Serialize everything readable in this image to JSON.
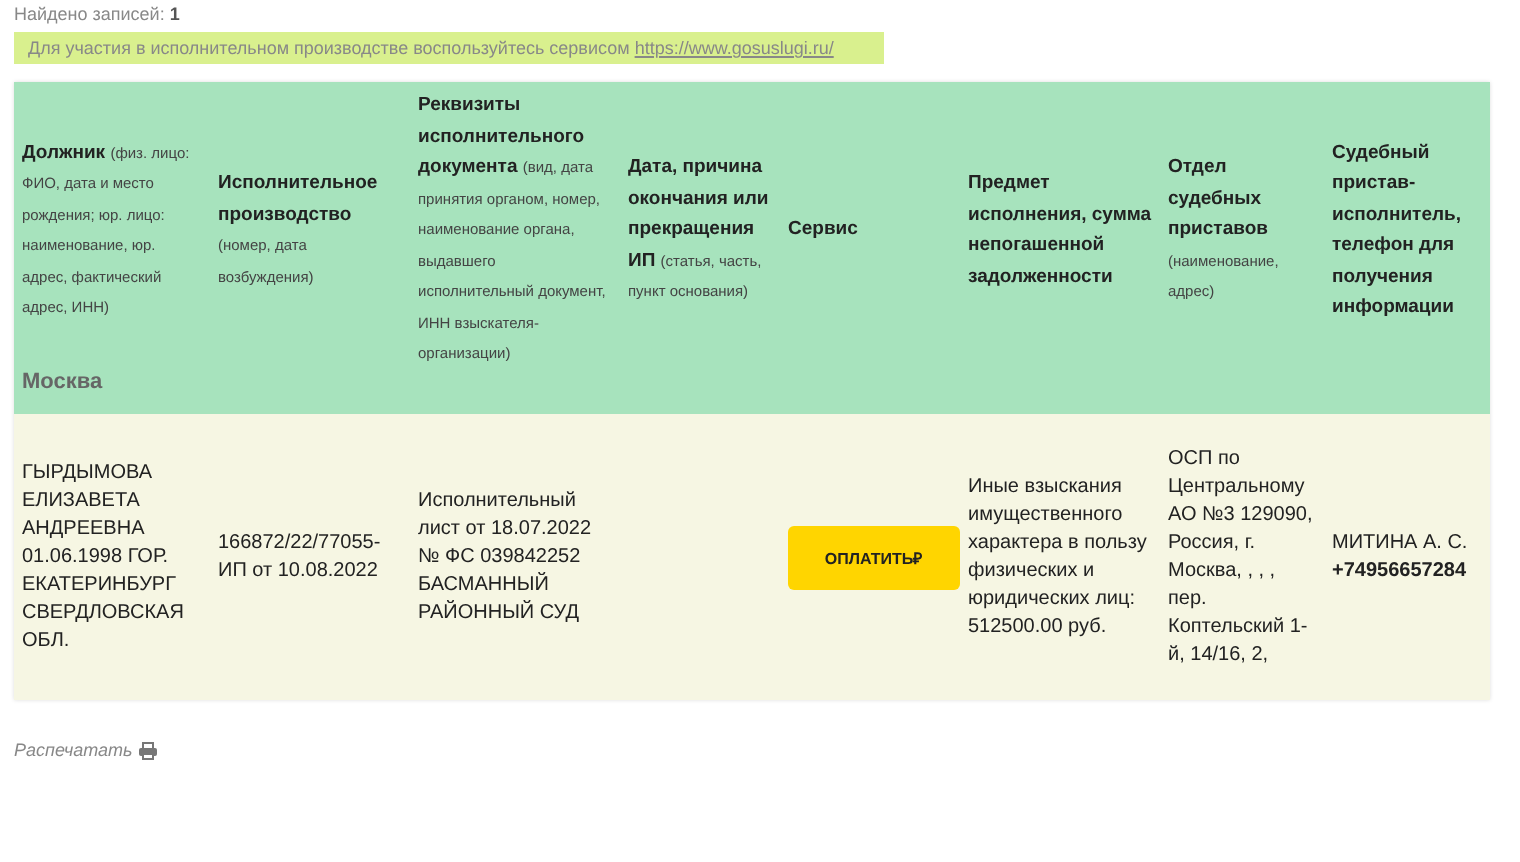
{
  "found": {
    "label": "Найдено записей:",
    "count": "1"
  },
  "notice": {
    "text": "Для участия в исполнительном производстве воспользуйтесь сервисом",
    "link": "https://www.gosuslugi.ru/"
  },
  "table": {
    "columns": [
      {
        "title": "Должник",
        "note": "(физ. лицо: ФИО, дата и место рождения; юр. лицо: наименование, юр. адрес, фактический адрес, ИНН)"
      },
      {
        "title": "Исполнительное производство",
        "note": "(номер, дата возбуждения)"
      },
      {
        "title": "Реквизиты исполнительного документа",
        "note": "(вид, дата принятия органом, номер, наименование органа, выдавшего исполнительный документ, ИНН взыскателя-организации)"
      },
      {
        "title": "Дата, причина окончания или прекращения ИП",
        "note": "(статья, часть, пункт основания)"
      },
      {
        "title": "Сервис"
      },
      {
        "title": "Предмет исполнения, сумма непогашенной задолженности"
      },
      {
        "title": "Отдел судебных приставов",
        "note": "(наименование, адрес)"
      },
      {
        "title": "Судебный пристав-исполнитель, телефон для получения информации"
      }
    ],
    "region": "Москва",
    "rows": [
      {
        "debtor": "ГЫРДЫМОВА ЕЛИЗАВЕТА АНДРЕЕВНА 01.06.1998 ГОР. ЕКАТЕРИНБУРГ СВЕРДЛОВСКАЯ ОБЛ.",
        "proceeding": "166872/22/77055-ИП от 10.08.2022",
        "document": "Исполнительный лист от 18.07.2022 № ФС 039842252 БАСМАННЫЙ РАЙОННЫЙ СУД",
        "pay_button": "ОПЛАТИТЬ₽",
        "subject": "Иные взыскания имущественного характера в пользу физических и юридических лиц: 512500.00 руб.",
        "department": "ОСП по Центральному АО №3 129090, Россия, г. Москва, , , , пер. Коптельский 1-й, 14/16, 2,",
        "officer": "МИТИНА А. С.",
        "phone": "+74956657284"
      }
    ]
  },
  "print_link": "Распечатать"
}
